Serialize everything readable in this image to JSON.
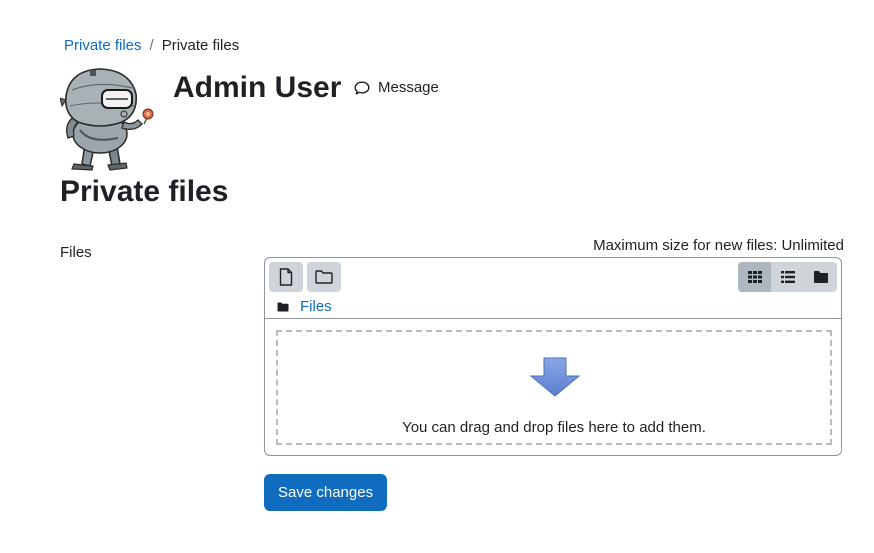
{
  "breadcrumb": {
    "items": [
      {
        "label": "Private files"
      },
      {
        "label": "Private files"
      }
    ],
    "separator": "/"
  },
  "profile": {
    "name": "Admin User",
    "message_label": "Message"
  },
  "page": {
    "title": "Private files"
  },
  "form": {
    "field_label": "Files",
    "max_size_text": "Maximum size for new files: Unlimited",
    "save_label": "Save changes"
  },
  "filemanager": {
    "toolbar": {
      "add_file_icon": "file-icon",
      "create_folder_icon": "folder-icon",
      "views": [
        {
          "icon": "grid-icon",
          "active": true
        },
        {
          "icon": "list-icon",
          "active": false
        },
        {
          "icon": "folder-tree-icon",
          "active": false
        }
      ]
    },
    "path_label": "Files",
    "dropzone_text": "You can drag and drop files here to add them."
  },
  "colors": {
    "link": "#0f6cbf",
    "primary_button": "#0f6cbf",
    "toolbar_button": "#ced4da",
    "drop_arrow": "#6f8fd9"
  }
}
